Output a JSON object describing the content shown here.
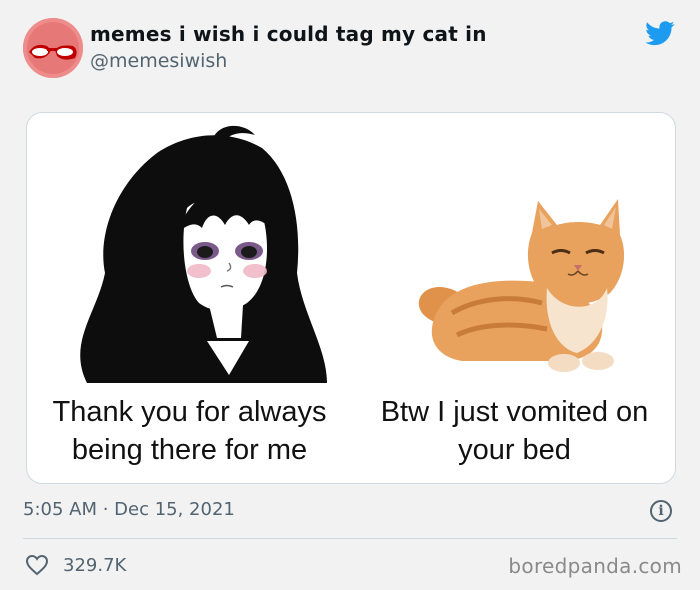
{
  "tweet": {
    "display_name": "memes i wish i could tag my cat in",
    "handle": "@memesiwish",
    "timestamp": "5:05 AM · Dec 15, 2021",
    "like_count": "329.7K"
  },
  "meme": {
    "left_caption": "Thank you for always being there for me",
    "right_caption": "Btw I just vomited on your bed"
  },
  "watermark": "boredpanda.com",
  "icons": {
    "brand": "twitter-bird-icon",
    "info": "info-icon",
    "like": "heart-icon"
  },
  "colors": {
    "twitter_blue": "#1d9bf0",
    "secondary_text": "#536471",
    "avatar_pink": "#ef8a8a"
  }
}
